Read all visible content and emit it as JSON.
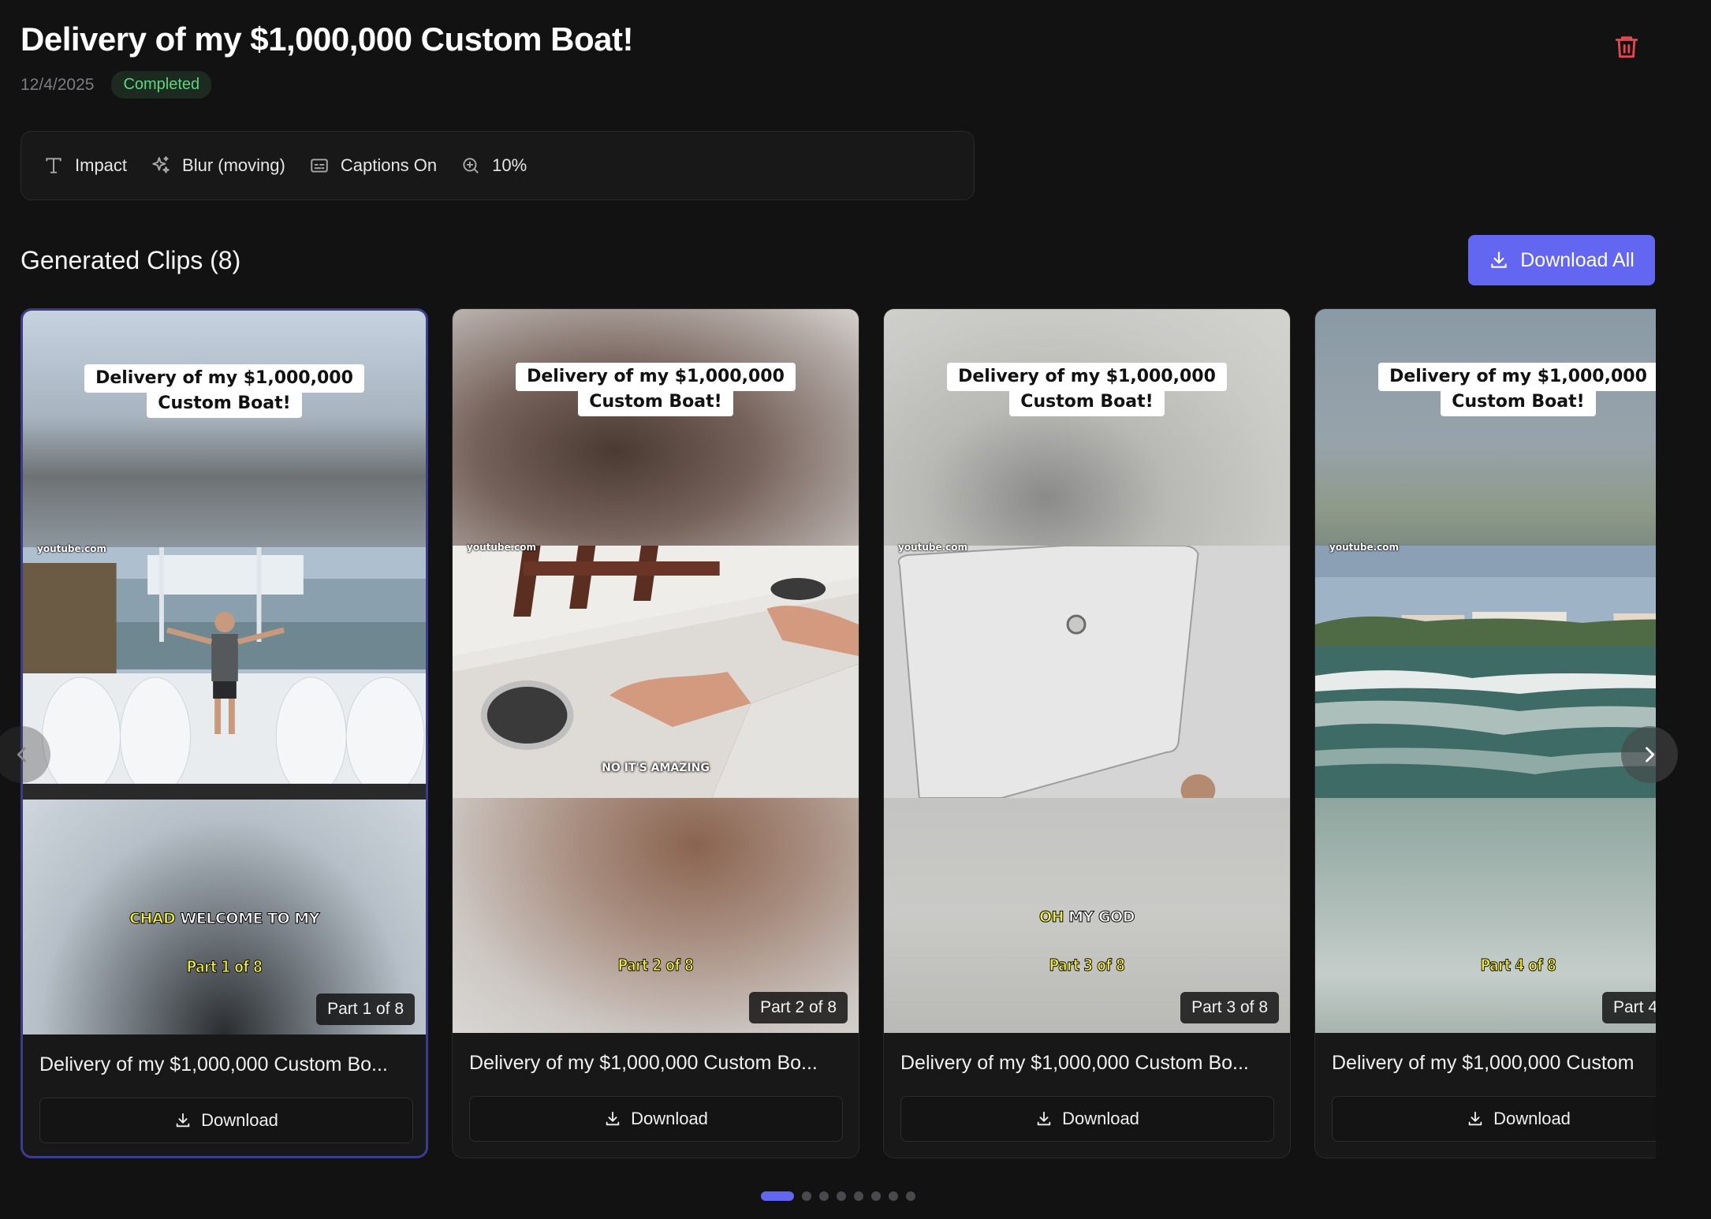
{
  "header": {
    "title": "Delivery of my $1,000,000 Custom Boat!",
    "date": "12/4/2025",
    "status": "Completed"
  },
  "settings": {
    "font": {
      "icon": "type-icon",
      "label": "Impact"
    },
    "background": {
      "icon": "sparkles-icon",
      "label": "Blur (moving)"
    },
    "captions": {
      "icon": "captions-icon",
      "label": "Captions On"
    },
    "zoom": {
      "icon": "zoom-in-icon",
      "label": "10%"
    }
  },
  "clips": {
    "heading": "Generated Clips (8)",
    "download_all_label": "Download All",
    "items": [
      {
        "caption_line1": "Delivery of my $1,000,000",
        "caption_line2": "Custom Boat!",
        "watermark": "youtube.com",
        "subtitle_highlight": "CHAD",
        "subtitle_rest": " WELCOME TO MY",
        "video_subtitle": "",
        "part_overlay": "Part 1 of 8",
        "part_badge": "Part 1 of 8",
        "title": "Delivery of my $1,000,000 Custom Bo...",
        "download_label": "Download"
      },
      {
        "caption_line1": "Delivery of my $1,000,000",
        "caption_line2": "Custom Boat!",
        "watermark": "youtube.com",
        "subtitle_highlight": "",
        "subtitle_rest": "",
        "video_subtitle": "NO IT'S AMAZING",
        "part_overlay": "Part 2 of 8",
        "part_badge": "Part 2 of 8",
        "title": "Delivery of my $1,000,000 Custom Bo...",
        "download_label": "Download"
      },
      {
        "caption_line1": "Delivery of my $1,000,000",
        "caption_line2": "Custom Boat!",
        "watermark": "youtube.com",
        "subtitle_highlight": "OH",
        "subtitle_rest": " MY GOD",
        "video_subtitle": "",
        "part_overlay": "Part 3 of 8",
        "part_badge": "Part 3 of 8",
        "title": "Delivery of my $1,000,000 Custom Bo...",
        "download_label": "Download"
      },
      {
        "caption_line1": "Delivery of my $1,000,000",
        "caption_line2": "Custom Boat!",
        "watermark": "youtube.com",
        "subtitle_highlight": "",
        "subtitle_rest": "",
        "video_subtitle": "",
        "part_overlay": "Part 4 of 8",
        "part_badge": "Part 4",
        "title": "Delivery of my $1,000,000 Custom",
        "download_label": "Download"
      }
    ]
  },
  "pagination": {
    "total": 8,
    "active": 1
  },
  "colors": {
    "accent": "#6366f1",
    "status_green": "#5fd47f",
    "danger": "#e5484d",
    "caption_yellow": "#f3ee3a"
  }
}
